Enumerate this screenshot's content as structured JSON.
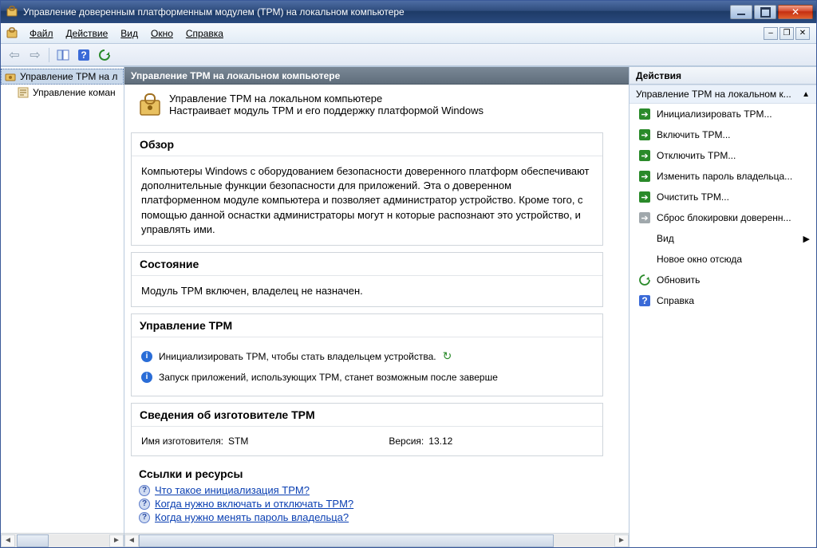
{
  "title": "Управление доверенным платформенным модулем (TPM) на локальном компьютере",
  "menu": {
    "file": "Файл",
    "action": "Действие",
    "view": "Вид",
    "window": "Окно",
    "help": "Справка"
  },
  "tree": {
    "root": "Управление TPM на л",
    "child": "Управление коман"
  },
  "mid": {
    "header": "Управление TPM на локальном компьютере",
    "intro_title": "Управление TPM на локальном компьютере",
    "intro_sub": "Настраивает модуль TPM и его поддержку платформой Windows",
    "overview": {
      "title": "Обзор",
      "text": "Компьютеры Windows с оборудованием безопасности доверенного платформ обеспечивают дополнительные функции безопасности для приложений. Эта о доверенном платформенном модуле компьютера и позволяет администратор устройство. Кроме того, с помощью данной оснастки администраторы могут н которые распознают это устройство, и управлять ими."
    },
    "status": {
      "title": "Состояние",
      "text": "Модуль TPM включен, владелец не назначен."
    },
    "manage": {
      "title": "Управление TPM",
      "line1": "Инициализировать TPM, чтобы стать владельцем устройства.",
      "line2": "Запуск приложений, использующих TPM, станет возможным после заверше"
    },
    "vendor": {
      "title": "Сведения об изготовителе TPM",
      "name_label": "Имя изготовителя:",
      "name_value": "STM",
      "version_label": "Версия:",
      "version_value": "13.12"
    },
    "links": {
      "title": "Ссылки и ресурсы",
      "l1": "Что такое инициализация TPM?",
      "l2": "Когда нужно включать и отключать TPM?",
      "l3": "Когда нужно менять пароль владельца?"
    }
  },
  "right": {
    "header": "Действия",
    "section": "Управление TPM на локальном к...",
    "a1": "Инициализировать TPM...",
    "a2": "Включить TPM...",
    "a3": "Отключить TPM...",
    "a4": "Изменить пароль владельца...",
    "a5": "Очистить TPM...",
    "a6": "Сброс блокировки доверенн...",
    "view": "Вид",
    "newwin": "Новое окно отсюда",
    "refresh": "Обновить",
    "help": "Справка"
  }
}
